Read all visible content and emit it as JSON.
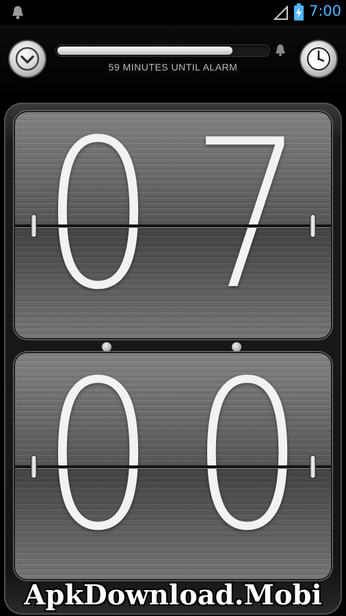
{
  "status_bar": {
    "time": "7:00",
    "icons": [
      "alarm-bell-icon",
      "signal-icon",
      "battery-charging-icon"
    ],
    "time_color": "#4fb4ff"
  },
  "alarm": {
    "countdown_text": "59 MINUTES UNTIL ALARM",
    "progress_percent": 83,
    "left_button_icon": "chevron-down-icon",
    "right_button_icon": "clock-icon"
  },
  "clock": {
    "hours": [
      "0",
      "7"
    ],
    "minutes": [
      "0",
      "0"
    ]
  },
  "watermark": "ApkDownload.Mobi"
}
